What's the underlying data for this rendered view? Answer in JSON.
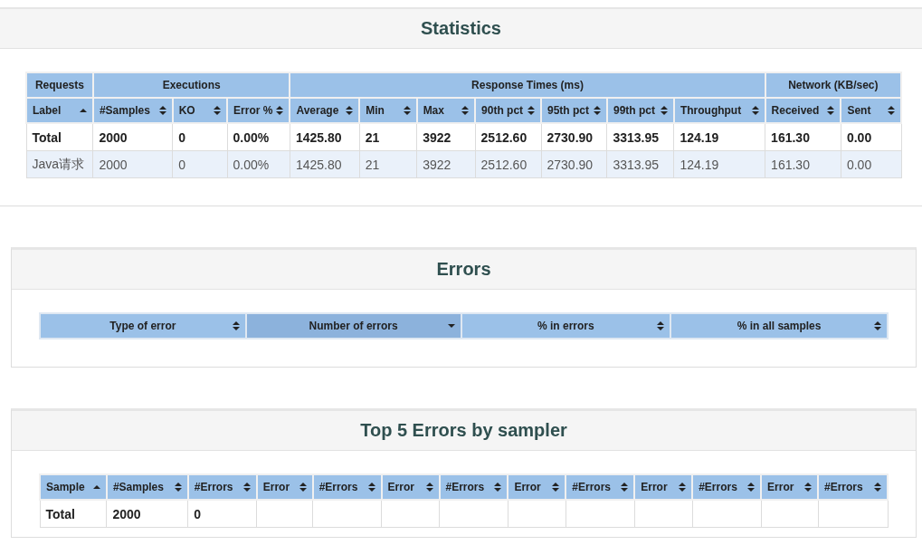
{
  "statistics": {
    "title": "Statistics",
    "groups": [
      "Requests",
      "Executions",
      "Response Times (ms)",
      "Network (KB/sec)"
    ],
    "columns": [
      {
        "label": "Label",
        "ascending": true,
        "descending": false
      },
      {
        "label": "#Samples",
        "ascending": false,
        "descending": false
      },
      {
        "label": "KO",
        "ascending": false,
        "descending": false
      },
      {
        "label": "Error %",
        "ascending": false,
        "descending": false
      },
      {
        "label": "Average",
        "ascending": false,
        "descending": false
      },
      {
        "label": "Min",
        "ascending": false,
        "descending": false
      },
      {
        "label": "Max",
        "ascending": false,
        "descending": false
      },
      {
        "label": "90th pct",
        "ascending": false,
        "descending": false
      },
      {
        "label": "95th pct",
        "ascending": false,
        "descending": false
      },
      {
        "label": "99th pct",
        "ascending": false,
        "descending": false
      },
      {
        "label": "Throughput",
        "ascending": false,
        "descending": false
      },
      {
        "label": "Received",
        "ascending": false,
        "descending": false
      },
      {
        "label": "Sent",
        "ascending": false,
        "descending": false
      }
    ],
    "rows": [
      {
        "total": true,
        "cells": [
          "Total",
          "2000",
          "0",
          "0.00%",
          "1425.80",
          "21",
          "3922",
          "2512.60",
          "2730.90",
          "3313.95",
          "124.19",
          "161.30",
          "0.00"
        ]
      },
      {
        "total": false,
        "cells": [
          "Java请求",
          "2000",
          "0",
          "0.00%",
          "1425.80",
          "21",
          "3922",
          "2512.60",
          "2730.90",
          "3313.95",
          "124.19",
          "161.30",
          "0.00"
        ]
      }
    ]
  },
  "errors": {
    "title": "Errors",
    "columns": [
      {
        "label": "Type of error",
        "ascending": false,
        "descending": false,
        "selected": false
      },
      {
        "label": "Number of errors",
        "ascending": false,
        "descending": true,
        "selected": true
      },
      {
        "label": "% in errors",
        "ascending": false,
        "descending": false,
        "selected": false
      },
      {
        "label": "% in all samples",
        "ascending": false,
        "descending": false,
        "selected": false
      }
    ]
  },
  "top_errors": {
    "title": "Top 5 Errors by sampler",
    "columns": [
      {
        "label": "Sample",
        "ascending": true,
        "descending": false
      },
      {
        "label": "#Samples",
        "ascending": false,
        "descending": false
      },
      {
        "label": "#Errors",
        "ascending": false,
        "descending": false
      },
      {
        "label": "Error",
        "ascending": false,
        "descending": false
      },
      {
        "label": "#Errors",
        "ascending": false,
        "descending": false
      },
      {
        "label": "Error",
        "ascending": false,
        "descending": false
      },
      {
        "label": "#Errors",
        "ascending": false,
        "descending": false
      },
      {
        "label": "Error",
        "ascending": false,
        "descending": false
      },
      {
        "label": "#Errors",
        "ascending": false,
        "descending": false
      },
      {
        "label": "Error",
        "ascending": false,
        "descending": false
      },
      {
        "label": "#Errors",
        "ascending": false,
        "descending": false
      },
      {
        "label": "Error",
        "ascending": false,
        "descending": false
      },
      {
        "label": "#Errors",
        "ascending": false,
        "descending": false
      }
    ],
    "rows": [
      {
        "total": true,
        "cells": [
          "Total",
          "2000",
          "0"
        ]
      }
    ]
  }
}
